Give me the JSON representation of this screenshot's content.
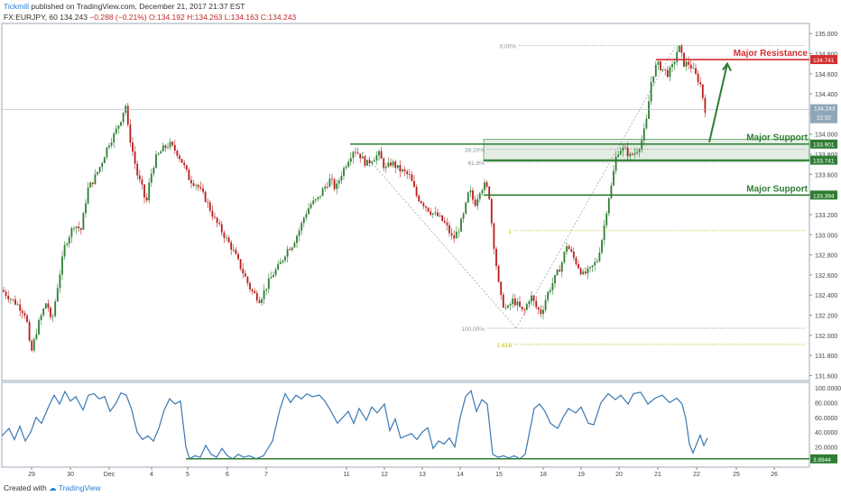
{
  "header": {
    "author": "Tickmill",
    "published": "published on TradingView.com, December 21, 2017 21:37 EST",
    "symbol": "FX:EURJPY, 60",
    "price": "134.243",
    "change": "−0.288 (−0.21%)",
    "open": "O:134.192",
    "high": "H:134.263",
    "low": "L:134.163",
    "close": "C:134.243"
  },
  "footer": {
    "created_with": "Created with",
    "brand": "TradingView"
  },
  "colors": {
    "up": "#2e7d32",
    "down": "#b71c1c",
    "resistance": "#d32f2f",
    "support": "#2e7d32",
    "oscillator": "#3a78b5",
    "fib": "#c8b400"
  },
  "chart_data": {
    "type": "candlestick",
    "instrument": "FX:EURJPY",
    "timeframe": "60",
    "price_axis": {
      "ticks": [
        "135.000",
        "134.800",
        "134.600",
        "134.400",
        "134.200",
        "134.000",
        "133.800",
        "133.600",
        "133.400",
        "133.200",
        "133.000",
        "132.800",
        "132.600",
        "132.400",
        "132.200",
        "132.000",
        "131.800",
        "131.600"
      ],
      "range": [
        131.55,
        135.1
      ]
    },
    "time_axis": {
      "ticks": [
        "29",
        "30",
        "Dec",
        "4",
        "5",
        "6",
        "7",
        "11",
        "12",
        "13",
        "14",
        "15",
        "18",
        "19",
        "20",
        "21",
        "22",
        "25",
        "26"
      ]
    },
    "price_path": [
      [
        0,
        132.45
      ],
      [
        8,
        132.38
      ],
      [
        18,
        132.3
      ],
      [
        27,
        132.2
      ],
      [
        32,
        131.8
      ],
      [
        40,
        132.1
      ],
      [
        50,
        132.35
      ],
      [
        55,
        132.1
      ],
      [
        62,
        132.5
      ],
      [
        70,
        132.9
      ],
      [
        80,
        133.1
      ],
      [
        88,
        133.05
      ],
      [
        95,
        133.45
      ],
      [
        102,
        133.55
      ],
      [
        110,
        133.7
      ],
      [
        118,
        133.9
      ],
      [
        125,
        134.0
      ],
      [
        132,
        134.15
      ],
      [
        137,
        134.3
      ],
      [
        140,
        134.05
      ],
      [
        146,
        133.78
      ],
      [
        150,
        133.6
      ],
      [
        156,
        133.45
      ],
      [
        160,
        133.3
      ],
      [
        164,
        133.55
      ],
      [
        170,
        133.75
      ],
      [
        178,
        133.85
      ],
      [
        186,
        133.9
      ],
      [
        194,
        133.82
      ],
      [
        200,
        133.72
      ],
      [
        208,
        133.55
      ],
      [
        216,
        133.5
      ],
      [
        226,
        133.35
      ],
      [
        236,
        133.15
      ],
      [
        246,
        133.0
      ],
      [
        256,
        132.85
      ],
      [
        266,
        132.65
      ],
      [
        276,
        132.45
      ],
      [
        286,
        132.35
      ],
      [
        294,
        132.5
      ],
      [
        300,
        132.6
      ],
      [
        308,
        132.7
      ],
      [
        316,
        132.85
      ],
      [
        322,
        132.9
      ],
      [
        330,
        133.05
      ],
      [
        336,
        133.2
      ],
      [
        342,
        133.3
      ],
      [
        350,
        133.35
      ],
      [
        356,
        133.45
      ],
      [
        364,
        133.55
      ],
      [
        370,
        133.45
      ],
      [
        376,
        133.6
      ],
      [
        384,
        133.75
      ],
      [
        390,
        133.85
      ],
      [
        396,
        133.8
      ],
      [
        404,
        133.7
      ],
      [
        410,
        133.75
      ],
      [
        418,
        133.8
      ],
      [
        425,
        133.65
      ],
      [
        432,
        133.72
      ],
      [
        440,
        133.65
      ],
      [
        446,
        133.62
      ],
      [
        452,
        133.58
      ],
      [
        460,
        133.38
      ],
      [
        468,
        133.3
      ],
      [
        476,
        133.22
      ],
      [
        484,
        133.18
      ],
      [
        492,
        133.1
      ],
      [
        500,
        132.95
      ],
      [
        506,
        133.05
      ],
      [
        512,
        133.2
      ],
      [
        518,
        133.45
      ],
      [
        524,
        133.3
      ],
      [
        530,
        133.45
      ],
      [
        536,
        133.5
      ],
      [
        540,
        133.4
      ],
      [
        544,
        133.0
      ],
      [
        548,
        132.7
      ],
      [
        552,
        132.4
      ],
      [
        556,
        132.3
      ],
      [
        560,
        132.25
      ],
      [
        566,
        132.35
      ],
      [
        572,
        132.3
      ],
      [
        578,
        132.22
      ],
      [
        586,
        132.4
      ],
      [
        592,
        132.28
      ],
      [
        598,
        132.22
      ],
      [
        604,
        132.4
      ],
      [
        612,
        132.55
      ],
      [
        620,
        132.7
      ],
      [
        626,
        132.9
      ],
      [
        632,
        132.8
      ],
      [
        638,
        132.7
      ],
      [
        644,
        132.6
      ],
      [
        652,
        132.65
      ],
      [
        660,
        132.75
      ],
      [
        666,
        133.0
      ],
      [
        672,
        133.35
      ],
      [
        676,
        133.5
      ],
      [
        680,
        133.75
      ],
      [
        684,
        133.85
      ],
      [
        690,
        133.85
      ],
      [
        696,
        133.78
      ],
      [
        702,
        133.82
      ],
      [
        708,
        133.9
      ],
      [
        714,
        134.1
      ],
      [
        720,
        134.55
      ],
      [
        726,
        134.7
      ],
      [
        732,
        134.65
      ],
      [
        738,
        134.6
      ],
      [
        744,
        134.68
      ],
      [
        750,
        134.88
      ],
      [
        756,
        134.7
      ],
      [
        762,
        134.7
      ],
      [
        768,
        134.6
      ],
      [
        774,
        134.5
      ],
      [
        780,
        134.22
      ]
    ],
    "price_path_x": "pixel column index (0-780) mapping to time axis",
    "levels": [
      {
        "name": "Major Resistance",
        "value": 134.741,
        "label": "134.741",
        "color": "#d32f2f"
      },
      {
        "name": "Major Support",
        "value": 133.901,
        "label": "133.901",
        "color": "#2e7d32"
      },
      {
        "name": "",
        "value": 133.741,
        "label": "133.741",
        "color": "#2e7d32"
      },
      {
        "name": "Major Support",
        "value": 133.394,
        "label": "133.394",
        "color": "#2e7d32"
      }
    ],
    "current_price": {
      "value": 134.243,
      "label": "134.243",
      "time_label": "22:32"
    },
    "fibonacci": [
      {
        "label": "0.00%",
        "value": 134.88
      },
      {
        "label": "38.20%",
        "value": 133.85
      },
      {
        "label": "61.8%",
        "value": 133.72
      },
      {
        "label": "100.00%",
        "value": 132.07
      },
      {
        "label": "1.618",
        "value": 131.91
      },
      {
        "label": "1",
        "value": 133.04
      }
    ],
    "oscillator": {
      "ticks": [
        "100.0000",
        "80.0000",
        "60.0000",
        "40.0000",
        "20.0000"
      ],
      "current": "3.8944",
      "range": [
        0,
        100
      ],
      "values": [
        [
          0,
          35
        ],
        [
          8,
          45
        ],
        [
          14,
          30
        ],
        [
          20,
          48
        ],
        [
          26,
          28
        ],
        [
          32,
          40
        ],
        [
          38,
          60
        ],
        [
          44,
          52
        ],
        [
          52,
          75
        ],
        [
          58,
          90
        ],
        [
          64,
          78
        ],
        [
          70,
          95
        ],
        [
          76,
          82
        ],
        [
          82,
          88
        ],
        [
          90,
          70
        ],
        [
          96,
          90
        ],
        [
          102,
          92
        ],
        [
          108,
          85
        ],
        [
          114,
          88
        ],
        [
          120,
          68
        ],
        [
          126,
          78
        ],
        [
          132,
          93
        ],
        [
          138,
          90
        ],
        [
          144,
          70
        ],
        [
          150,
          40
        ],
        [
          156,
          30
        ],
        [
          162,
          35
        ],
        [
          168,
          28
        ],
        [
          174,
          45
        ],
        [
          180,
          70
        ],
        [
          186,
          85
        ],
        [
          192,
          78
        ],
        [
          198,
          82
        ],
        [
          204,
          20
        ],
        [
          208,
          4
        ],
        [
          214,
          8
        ],
        [
          220,
          6
        ],
        [
          226,
          22
        ],
        [
          232,
          10
        ],
        [
          238,
          6
        ],
        [
          244,
          18
        ],
        [
          250,
          8
        ],
        [
          256,
          4
        ],
        [
          262,
          10
        ],
        [
          268,
          6
        ],
        [
          274,
          8
        ],
        [
          282,
          4
        ],
        [
          290,
          8
        ],
        [
          300,
          28
        ],
        [
          308,
          70
        ],
        [
          314,
          92
        ],
        [
          320,
          80
        ],
        [
          326,
          90
        ],
        [
          332,
          85
        ],
        [
          338,
          92
        ],
        [
          344,
          88
        ],
        [
          352,
          90
        ],
        [
          358,
          82
        ],
        [
          364,
          70
        ],
        [
          372,
          52
        ],
        [
          378,
          60
        ],
        [
          384,
          68
        ],
        [
          390,
          52
        ],
        [
          396,
          72
        ],
        [
          404,
          56
        ],
        [
          410,
          74
        ],
        [
          416,
          66
        ],
        [
          424,
          78
        ],
        [
          430,
          42
        ],
        [
          436,
          58
        ],
        [
          442,
          32
        ],
        [
          448,
          35
        ],
        [
          454,
          38
        ],
        [
          460,
          30
        ],
        [
          466,
          40
        ],
        [
          472,
          46
        ],
        [
          478,
          18
        ],
        [
          484,
          28
        ],
        [
          490,
          24
        ],
        [
          496,
          32
        ],
        [
          502,
          20
        ],
        [
          508,
          60
        ],
        [
          514,
          88
        ],
        [
          520,
          96
        ],
        [
          526,
          68
        ],
        [
          532,
          84
        ],
        [
          538,
          78
        ],
        [
          544,
          10
        ],
        [
          550,
          6
        ],
        [
          556,
          8
        ],
        [
          562,
          5
        ],
        [
          568,
          8
        ],
        [
          574,
          4
        ],
        [
          580,
          10
        ],
        [
          590,
          72
        ],
        [
          596,
          78
        ],
        [
          602,
          68
        ],
        [
          608,
          52
        ],
        [
          616,
          45
        ],
        [
          622,
          60
        ],
        [
          628,
          72
        ],
        [
          636,
          66
        ],
        [
          642,
          74
        ],
        [
          650,
          52
        ],
        [
          656,
          50
        ],
        [
          664,
          80
        ],
        [
          672,
          92
        ],
        [
          680,
          84
        ],
        [
          686,
          90
        ],
        [
          694,
          78
        ],
        [
          700,
          92
        ],
        [
          708,
          94
        ],
        [
          716,
          78
        ],
        [
          724,
          86
        ],
        [
          732,
          90
        ],
        [
          740,
          80
        ],
        [
          748,
          86
        ],
        [
          754,
          78
        ],
        [
          758,
          58
        ],
        [
          762,
          24
        ],
        [
          766,
          12
        ],
        [
          770,
          24
        ],
        [
          774,
          36
        ],
        [
          778,
          22
        ],
        [
          782,
          32
        ]
      ],
      "values_note": "x is pixel column index; y is oscillator value 0-100"
    },
    "annotations": [
      "Major Resistance",
      "Major Support",
      "Major Support"
    ]
  }
}
